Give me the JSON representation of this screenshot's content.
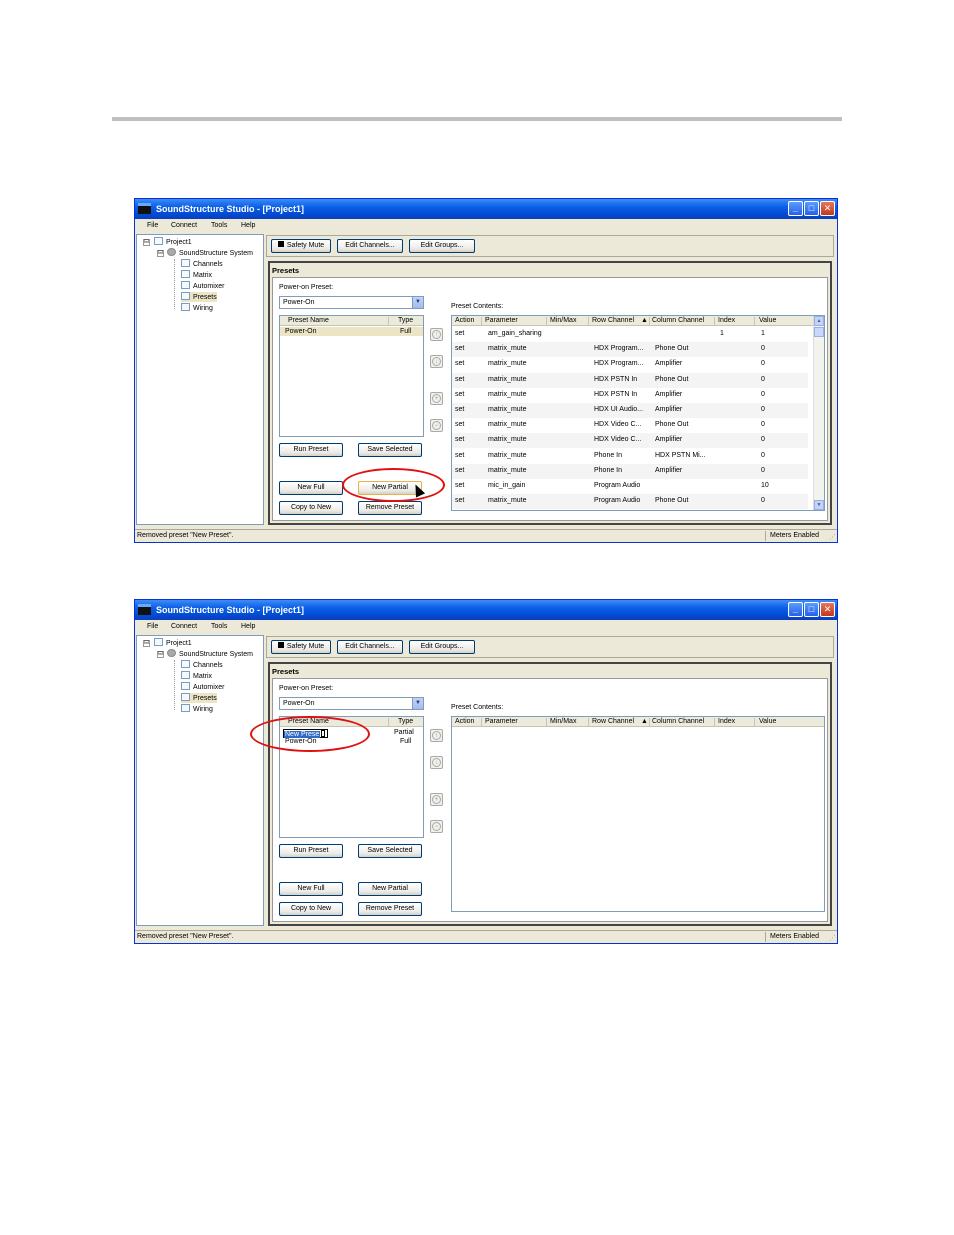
{
  "window": {
    "title": "SoundStructure Studio - [Project1]",
    "minimize_glyph": "_",
    "maximize_glyph": "□",
    "close_glyph": "✕"
  },
  "menu": [
    "File",
    "Connect",
    "Tools",
    "Help"
  ],
  "tree": {
    "root": "Project1",
    "system": "SoundStructure System",
    "items": [
      "Channels",
      "Matrix",
      "Automixer",
      "Presets",
      "Wiring"
    ],
    "toggle": "⊟"
  },
  "toolbar": {
    "safety_mute": "Safety Mute",
    "edit_channels": "Edit Channels...",
    "edit_groups": "Edit Groups..."
  },
  "presets": {
    "title": "Presets",
    "power_on_label": "Power-on Preset:",
    "power_on_value": "Power-On",
    "dropdown_arrow": "▼",
    "contents_label": "Preset Contents:",
    "list_headers": [
      "Preset Name",
      "Type"
    ],
    "contents_headers": [
      "Action",
      "Parameter",
      "Min/Max",
      "Row Channel",
      "Column Channel",
      "Index",
      "Value"
    ],
    "sort_glyph": "▲",
    "buttons": {
      "run": "Run Preset",
      "save_selected": "Save Selected",
      "new_full": "New Full",
      "new_partial": "New Partial",
      "copy_to_new": "Copy to New",
      "remove": "Remove Preset"
    },
    "arrow_glyphs": [
      "↑",
      "↓",
      "+",
      "−"
    ],
    "scroll_up": "▲",
    "scroll_down": "▼"
  },
  "screen1": {
    "preset_rows": [
      {
        "name": "Power-On",
        "type": "Full"
      }
    ],
    "content_rows": [
      {
        "action": "set",
        "parameter": "am_gain_sharing",
        "minmax": "",
        "row": "",
        "col": "",
        "index": "1",
        "value": "1"
      },
      {
        "action": "set",
        "parameter": "matrix_mute",
        "minmax": "",
        "row": "HDX Program...",
        "col": "Phone Out",
        "index": "",
        "value": "0"
      },
      {
        "action": "set",
        "parameter": "matrix_mute",
        "minmax": "",
        "row": "HDX Program...",
        "col": "Amplifier",
        "index": "",
        "value": "0"
      },
      {
        "action": "set",
        "parameter": "matrix_mute",
        "minmax": "",
        "row": "HDX PSTN In",
        "col": "Phone Out",
        "index": "",
        "value": "0"
      },
      {
        "action": "set",
        "parameter": "matrix_mute",
        "minmax": "",
        "row": "HDX PSTN In",
        "col": "Amplifier",
        "index": "",
        "value": "0"
      },
      {
        "action": "set",
        "parameter": "matrix_mute",
        "minmax": "",
        "row": "HDX UI Audio...",
        "col": "Amplifier",
        "index": "",
        "value": "0"
      },
      {
        "action": "set",
        "parameter": "matrix_mute",
        "minmax": "",
        "row": "HDX Video C...",
        "col": "Phone Out",
        "index": "",
        "value": "0"
      },
      {
        "action": "set",
        "parameter": "matrix_mute",
        "minmax": "",
        "row": "HDX Video C...",
        "col": "Amplifier",
        "index": "",
        "value": "0"
      },
      {
        "action": "set",
        "parameter": "matrix_mute",
        "minmax": "",
        "row": "Phone In",
        "col": "HDX PSTN Mi...",
        "index": "",
        "value": "0"
      },
      {
        "action": "set",
        "parameter": "matrix_mute",
        "minmax": "",
        "row": "Phone In",
        "col": "Amplifier",
        "index": "",
        "value": "0"
      },
      {
        "action": "set",
        "parameter": "mic_in_gain",
        "minmax": "",
        "row": "Program Audio",
        "col": "",
        "index": "",
        "value": "10"
      },
      {
        "action": "set",
        "parameter": "matrix_mute",
        "minmax": "",
        "row": "Program Audio",
        "col": "Phone Out",
        "index": "",
        "value": "0"
      }
    ]
  },
  "screen2": {
    "editing_name": "New Prese",
    "editing_type": "Partial",
    "preset_rows": [
      {
        "name": "Power-On",
        "type": "Full"
      }
    ]
  },
  "status": {
    "message": "Removed preset \"New Preset\".",
    "meters": "Meters Enabled",
    "grip": "⋰"
  }
}
